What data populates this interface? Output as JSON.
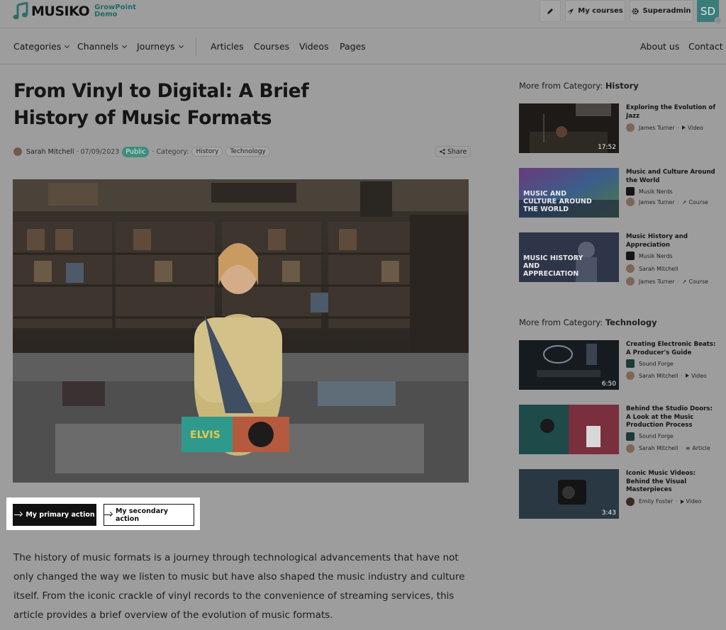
{
  "brand": {
    "name": "MUSIKO",
    "sub_line1": "GrowPoint",
    "sub_line2": "Demo"
  },
  "topbar": {
    "edit_icon": "pencil-icon",
    "my_courses": "My courses",
    "superadmin": "Superadmin",
    "avatar_initials": "SD"
  },
  "nav": {
    "categories": "Categories",
    "channels": "Channels",
    "journeys": "Journeys",
    "articles": "Articles",
    "courses": "Courses",
    "videos": "Videos",
    "pages": "Pages",
    "about": "About us",
    "contact": "Contact"
  },
  "article": {
    "title": "From Vinyl to Digital: A Brief History of Music Formats",
    "author": "Sarah Mitchell",
    "date": "07/09/2023",
    "visibility": "Public",
    "category_label": "Category:",
    "tags": [
      "History",
      "Technology"
    ],
    "share": "Share",
    "body": "The history of music formats is a journey through technological advancements that have not only changed the way we listen to music but have also shaped the music industry and culture itself. From the iconic crackle of vinyl records to the convenience of streaming services, this article provides a brief overview of the evolution of music formats."
  },
  "actions": {
    "primary": "My primary action",
    "secondary": "My secondary action"
  },
  "sidebar": {
    "history": {
      "prefix": "More from Category:",
      "name": "History",
      "items": [
        {
          "title": "Exploring the Evolution of Jazz",
          "author": "James Turner",
          "type": "Video",
          "duration": "17:52"
        },
        {
          "title": "Music and Culture Around the World",
          "channel": "Musik Nerds",
          "author": "James Turner",
          "type": "Course",
          "caption": "MUSIC AND CULTURE AROUND THE WORLD"
        },
        {
          "title": "Music History and Appreciation",
          "channel": "Musik Nerds",
          "author": "Sarah Mitchell",
          "author2": "James Turner",
          "type": "Course",
          "caption": "MUSIC HISTORY AND APPRECIATION"
        }
      ]
    },
    "technology": {
      "prefix": "More from Category:",
      "name": "Technology",
      "items": [
        {
          "title": "Creating Electronic Beats: A Producer's Guide",
          "channel": "Sound Forge",
          "author": "Sarah Mitchell",
          "type": "Video",
          "duration": "6:50"
        },
        {
          "title": "Behind the Studio Doors: A Look at the Music Production Process",
          "channel": "Sound Forge",
          "author": "Sarah Mitchell",
          "type": "Article"
        },
        {
          "title": "Iconic Music Videos: Behind the Visual Masterpieces",
          "author": "Emily Foster",
          "type": "Video",
          "duration": "3:43"
        }
      ]
    }
  },
  "colors": {
    "accent": "#3f8d7b",
    "overlay": "#9d9d9d",
    "primary_button": "#111111"
  }
}
